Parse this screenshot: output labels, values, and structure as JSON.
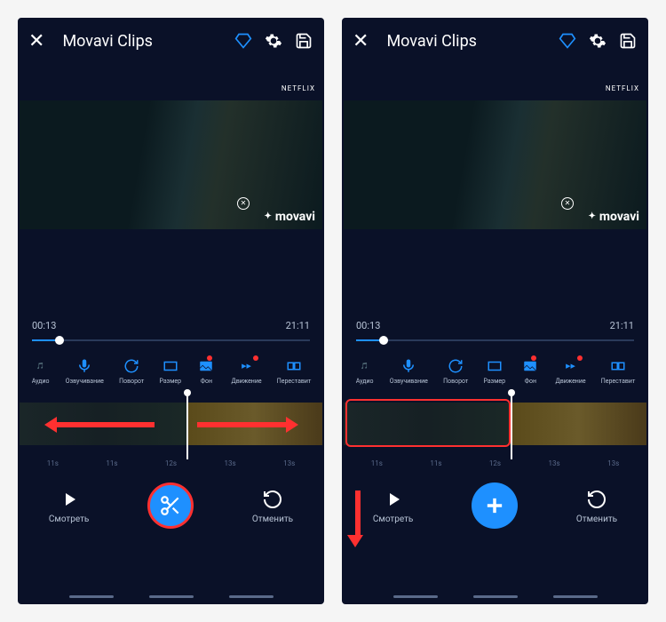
{
  "app": {
    "title": "Movavi Clips"
  },
  "watermark": {
    "logo": "movavi",
    "provider": "NETFLIX"
  },
  "time": {
    "current": "00:13",
    "total": "21:11"
  },
  "tools": [
    {
      "id": "audio",
      "label": "Аудио",
      "icon": "audio"
    },
    {
      "id": "voice",
      "label": "Озвучивание",
      "icon": "mic"
    },
    {
      "id": "rotate",
      "label": "Поворот",
      "icon": "rotate"
    },
    {
      "id": "size",
      "label": "Размер",
      "icon": "size"
    },
    {
      "id": "bg",
      "label": "Фон",
      "icon": "bg",
      "badge": true
    },
    {
      "id": "motion",
      "label": "Движение",
      "icon": "motion",
      "badge": true
    },
    {
      "id": "reorder",
      "label": "Переставит",
      "icon": "reorder"
    }
  ],
  "ruler": [
    "11s",
    "11s",
    "12s",
    "13s",
    "13s"
  ],
  "actions": {
    "watch": "Смотреть",
    "undo": "Отменить"
  },
  "screens": {
    "left": {
      "center_button": "cut",
      "annotations": "split-arrows"
    },
    "right": {
      "center_button": "add",
      "annotations": "select-and-down"
    }
  }
}
